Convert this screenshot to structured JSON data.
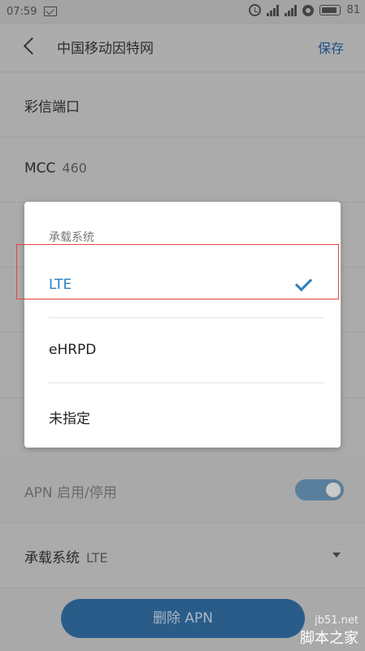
{
  "status_bar": {
    "time": "07:59",
    "battery_level": "81",
    "icons": [
      "message-icon",
      "alarm-icon",
      "signal-icon",
      "signal-icon",
      "dnd-icon",
      "battery-icon"
    ]
  },
  "header": {
    "back_icon": "back-icon",
    "title": "中国移动因特网",
    "save_label": "保存",
    "accent_color": "#1b4f84"
  },
  "rows": {
    "mms_port": {
      "label": "彩信端口"
    },
    "mcc": {
      "label": "MCC",
      "value": "460"
    },
    "apn_toggle": {
      "label": "APN 启用/停用",
      "enabled": true
    },
    "bearer": {
      "label": "承载系统",
      "value": "LTE"
    }
  },
  "delete_button": {
    "label": "删除 APN"
  },
  "dialog": {
    "title": "承载系统",
    "options": [
      {
        "label": "LTE",
        "selected": true
      },
      {
        "label": "eHRPD",
        "selected": false
      },
      {
        "label": "未指定",
        "selected": false
      }
    ],
    "selected_color": "#2a7fc1"
  },
  "watermark": {
    "url": "jb51.net",
    "name": "脚本之家"
  }
}
